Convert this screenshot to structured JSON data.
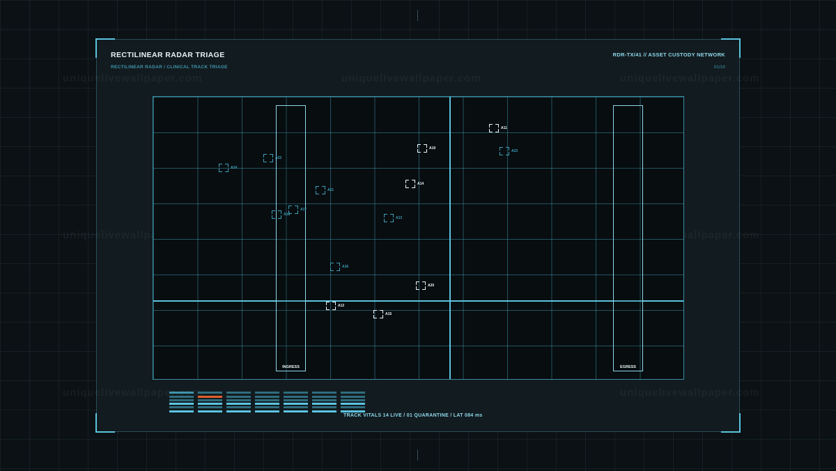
{
  "header": {
    "title": "RECTILINEAR RADAR TRIAGE",
    "subtitle": "RECTILINEAR RADAR / CLINICAL TRACK TRIAGE",
    "network": "RDR-TX/41  //  ASSET CUSTODY NETWORK",
    "pager": "01/10"
  },
  "watermark": "uniquelivewallpaper.com",
  "lanes": {
    "ingress": "INGRESS",
    "egress": "EGRESS"
  },
  "tracks": [
    {
      "id": "A11",
      "state": "active"
    },
    {
      "id": "A19",
      "state": "active"
    },
    {
      "id": "A23",
      "state": "dim"
    },
    {
      "id": "A24",
      "state": "dim"
    },
    {
      "id": "A22",
      "state": "dim"
    },
    {
      "id": "A14",
      "state": "active"
    },
    {
      "id": "A21",
      "state": "dim"
    },
    {
      "id": "A17",
      "state": "dim"
    },
    {
      "id": "A18",
      "state": "dim"
    },
    {
      "id": "A13",
      "state": "dim"
    },
    {
      "id": "A16",
      "state": "dim"
    },
    {
      "id": "A20",
      "state": "active"
    },
    {
      "id": "A12",
      "state": "active"
    },
    {
      "id": "A15",
      "state": "active"
    }
  ],
  "vitals": {
    "text": "TRACK VITALS  14 LIVE  /  01 QUARANTINE  /  LAT 084 ms",
    "columns": 7,
    "alert_column": 1,
    "alert_color": "#e0602a",
    "accent_color": "#5cc4e0"
  }
}
